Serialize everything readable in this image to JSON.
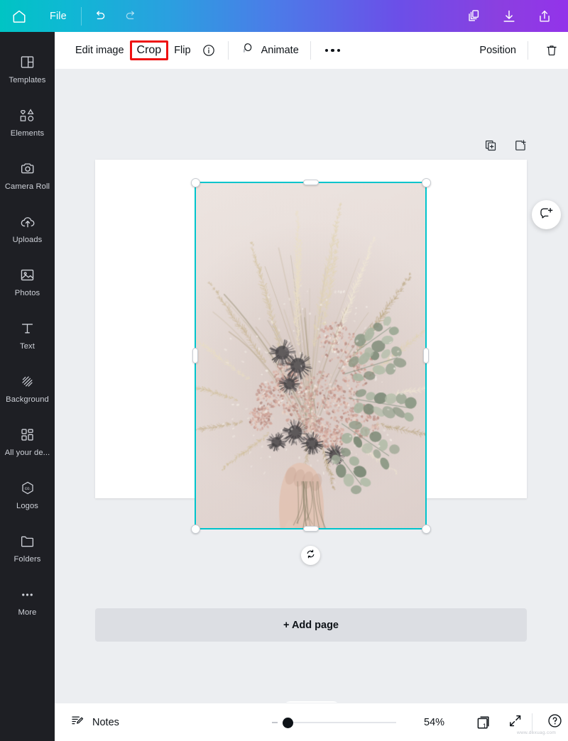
{
  "topbar": {
    "home_icon": "home-icon",
    "file_label": "File",
    "undo_icon": "undo-icon",
    "redo_icon": "redo-icon",
    "layers_icon": "duplicate-layers-icon",
    "download_icon": "download-icon",
    "share_icon": "share-upload-icon",
    "gradient_start": "#00c4c4",
    "gradient_end": "#9333ea"
  },
  "sidebar": {
    "background": "#1e1f24",
    "items": [
      {
        "label": "Templates",
        "icon": "templates-icon"
      },
      {
        "label": "Elements",
        "icon": "elements-icon"
      },
      {
        "label": "Camera Roll",
        "icon": "camera-icon"
      },
      {
        "label": "Uploads",
        "icon": "upload-cloud-icon"
      },
      {
        "label": "Photos",
        "icon": "photos-icon"
      },
      {
        "label": "Text",
        "icon": "text-t-icon"
      },
      {
        "label": "Background",
        "icon": "background-hatch-icon"
      },
      {
        "label": "All your de...",
        "icon": "grid-squares-icon"
      },
      {
        "label": "Logos",
        "icon": "logos-hexagon-icon"
      },
      {
        "label": "Folders",
        "icon": "folder-icon"
      },
      {
        "label": "More",
        "icon": "more-dots-icon"
      }
    ]
  },
  "toolbar": {
    "edit_image_label": "Edit image",
    "crop_label": "Crop",
    "crop_highlight_color": "#ee1111",
    "flip_label": "Flip",
    "info_icon": "info-circle-icon",
    "animate_icon": "animate-icon",
    "animate_label": "Animate",
    "more_icon": "more-dots-icon",
    "position_label": "Position",
    "trash_icon": "trash-icon"
  },
  "editor": {
    "background": "#eceef1",
    "page_background": "#ffffff",
    "duplicate_page_icon": "duplicate-page-icon",
    "add_page_icon": "add-page-icon",
    "selection_color": "#00c4cc",
    "rotate_icon": "rotate-icon",
    "add_page_label": "+ Add page",
    "chat_icon": "chat-add-icon",
    "image": {
      "alt": "dried flower bouquet held in hand",
      "bg_color": "#e4dad6"
    }
  },
  "bottombar": {
    "collapse_icon": "chevron-up-icon",
    "notes_icon": "notes-pencil-icon",
    "notes_label": "Notes",
    "zoom_value": "54%",
    "page_count": "1",
    "pages_icon": "pages-stack-icon",
    "expand_icon": "expand-arrows-icon",
    "help_icon": "help-circle-icon",
    "watermark": "www.dexuag.com"
  }
}
